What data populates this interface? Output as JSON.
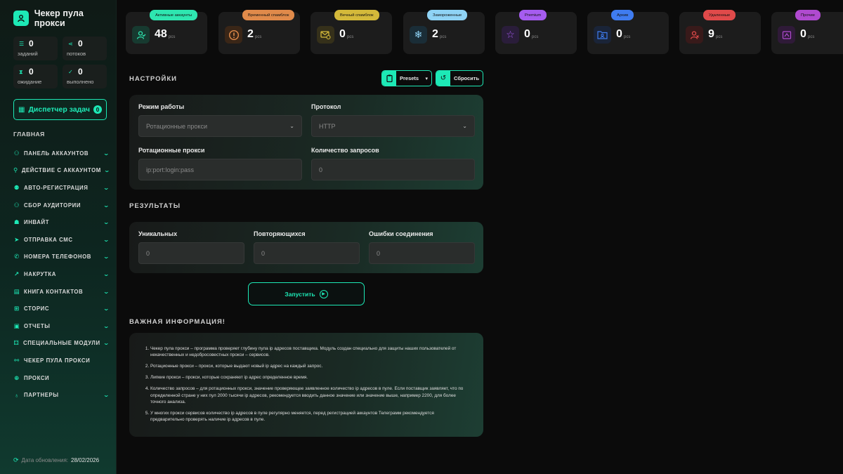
{
  "app": {
    "title": "Чекер пула прокси"
  },
  "sidebar": {
    "stats": [
      {
        "value": "0",
        "label": "заданий",
        "icon": "list-icon"
      },
      {
        "value": "0",
        "label": "потоков",
        "icon": "share-icon"
      },
      {
        "value": "0",
        "label": "ожидание",
        "icon": "hourglass-icon"
      },
      {
        "value": "0",
        "label": "выполнено",
        "icon": "check-circle-icon"
      }
    ],
    "task_manager": {
      "label": "Диспетчер задач",
      "count": "0"
    },
    "section_title": "ГЛАВНАЯ",
    "items": [
      {
        "label": "ПАНЕЛЬ АККАУНТОВ",
        "icon": "users-icon",
        "has_chevron": true
      },
      {
        "label": "ДЕЙСТВИЕ С АККАУНТОМ",
        "icon": "user-icon",
        "has_chevron": true
      },
      {
        "label": "АВТО-РЕГИСТРАЦИЯ",
        "icon": "user-plus-icon",
        "has_chevron": true
      },
      {
        "label": "СБОР АУДИТОРИИ",
        "icon": "audience-icon",
        "has_chevron": true
      },
      {
        "label": "ИНВАЙТ",
        "icon": "invite-icon",
        "has_chevron": true
      },
      {
        "label": "ОТПРАВКА СМС",
        "icon": "send-icon",
        "has_chevron": true
      },
      {
        "label": "НОМЕРА ТЕЛЕФОНОВ",
        "icon": "phone-icon",
        "has_chevron": true
      },
      {
        "label": "НАКРУТКА",
        "icon": "boost-icon",
        "has_chevron": true
      },
      {
        "label": "КНИГА КОНТАКТОВ",
        "icon": "book-icon",
        "has_chevron": true
      },
      {
        "label": "СТОРИС",
        "icon": "stories-icon",
        "has_chevron": true
      },
      {
        "label": "ОТЧЕТЫ",
        "icon": "reports-icon",
        "has_chevron": true
      },
      {
        "label": "СПЕЦИАЛЬНЫЕ МОДУЛИ",
        "icon": "modules-icon",
        "has_chevron": true
      },
      {
        "label": "ЧЕКЕР ПУЛА ПРОКСИ",
        "icon": "proxy-checker-icon",
        "has_chevron": false
      },
      {
        "label": "ПРОКСИ",
        "icon": "globe-icon",
        "has_chevron": false
      },
      {
        "label": "ПАРТНЕРЫ",
        "icon": "partners-icon",
        "has_chevron": true
      }
    ],
    "update": {
      "label": "Дата обновления:",
      "date": "28/02/2026"
    }
  },
  "cards": [
    {
      "pill": "Активные аккаунты",
      "value": "48",
      "unit": "pcs",
      "color": "#2ee6b0",
      "icon": "user-check-icon"
    },
    {
      "pill": "Временный спамблок",
      "value": "2",
      "unit": "pcs",
      "color": "#e08a4a",
      "icon": "warning-icon"
    },
    {
      "pill": "Вечный спамблок",
      "value": "0",
      "unit": "pcs",
      "color": "#d4b93a",
      "icon": "mail-block-icon"
    },
    {
      "pill": "Замороженные",
      "value": "2",
      "unit": "pcs",
      "color": "#8fd3f5",
      "icon": "snowflake-icon"
    },
    {
      "pill": "Premium",
      "value": "0",
      "unit": "pcs",
      "color": "#a65cf0",
      "icon": "star-icon"
    },
    {
      "pill": "Архив",
      "value": "0",
      "unit": "pcs",
      "color": "#3f7cf0",
      "icon": "archive-icon"
    },
    {
      "pill": "Удаленные",
      "value": "9",
      "unit": "pcs",
      "color": "#e04a4a",
      "icon": "user-x-icon"
    },
    {
      "pill": "Прочие",
      "value": "0",
      "unit": "pcs",
      "color": "#b04ad0",
      "icon": "other-icon"
    }
  ],
  "settings": {
    "title": "НАСТРОЙКИ",
    "presets_label": "Presets",
    "reset_label": "Сбросить",
    "mode_label": "Режим работы",
    "mode_value": "Ротационные прокси",
    "protocol_label": "Протокол",
    "protocol_value": "HTTP",
    "rotating_label": "Ротационные прокси",
    "rotating_placeholder": "ip:port:login:pass",
    "requests_label": "Количество запросов",
    "requests_placeholder": "0"
  },
  "results": {
    "title": "РЕЗУЛЬТАТЫ",
    "unique_label": "Уникальных",
    "unique_value": "0",
    "repeat_label": "Повторяющихся",
    "repeat_value": "0",
    "errors_label": "Ошибки соединения",
    "errors_value": "0"
  },
  "run_label": "Запустить",
  "info": {
    "title": "ВАЖНАЯ ИНФОРМАЦИЯ!",
    "items": [
      "Чекер пула прокси – программа проверяет глубину пула ip адресов поставщика. Модуль создан специально для защиты наших пользователей от некачественных и недобросовестных прокси – сервисов.",
      "Ротационные прокси – прокси, которые выдают новый ip адрес на каждый запрос.",
      "Липкие прокси – прокси, которые сохраняют ip адрес определенное время.",
      "Количество запросов – для ротационных прокси, значение проверяющее заявленное количество ip адресов в пуле. Если поставщик заявляет, что по определенной стране у них пул 2000 тысячи ip адресов, рекомендуется вводить данное значение или значение выше, например 2200, для более точного анализа.",
      "У многих прокси сервисов количество ip адресов в пуле регулярно меняется, перед регистрацией аккаунтов Телеграмм рекомендуется предварительно проверять наличие ip адресов в пуле."
    ]
  }
}
